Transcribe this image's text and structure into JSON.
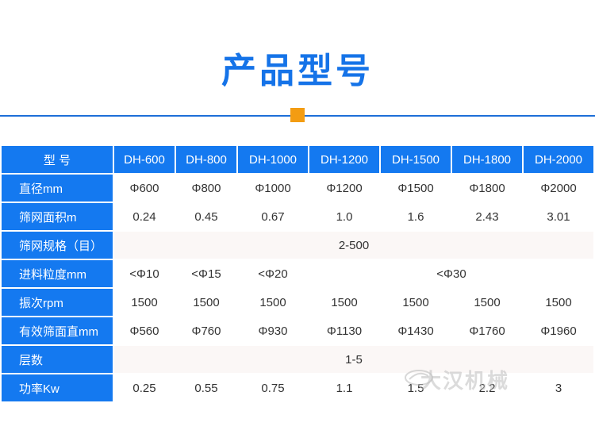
{
  "title": "产品型号",
  "header": {
    "label": "型 号",
    "models": [
      "DH-600",
      "DH-800",
      "DH-1000",
      "DH-1200",
      "DH-1500",
      "DH-1800",
      "DH-2000"
    ]
  },
  "rows": {
    "diameter": {
      "label": "直径mm",
      "values": [
        "Φ600",
        "Φ800",
        "Φ1000",
        "Φ1200",
        "Φ1500",
        "Φ1800",
        "Φ2000"
      ]
    },
    "area": {
      "label": "筛网面积m",
      "values": [
        "0.24",
        "0.45",
        "0.67",
        "1.0",
        "1.6",
        "2.43",
        "3.01"
      ]
    },
    "mesh": {
      "label": "筛网规格（目）",
      "value": "2-500"
    },
    "feed": {
      "label": "进料粒度mm",
      "values": [
        "<Φ10",
        "<Φ15",
        "<Φ20"
      ],
      "merged": "<Φ30"
    },
    "vibration": {
      "label": "振次rpm",
      "values": [
        "1500",
        "1500",
        "1500",
        "1500",
        "1500",
        "1500",
        "1500"
      ]
    },
    "effective": {
      "label": "有效筛面直mm",
      "values": [
        "Φ560",
        "Φ760",
        "Φ930",
        "Φ1130",
        "Φ1430",
        "Φ1760",
        "Φ1960"
      ]
    },
    "layers": {
      "label": "层数",
      "value": "1-5"
    },
    "power": {
      "label": "功率Kw",
      "values": [
        "0.25",
        "0.55",
        "0.75",
        "1.1",
        "1.5",
        "2.2",
        "3"
      ]
    }
  },
  "watermark": "大汉机械",
  "colors": {
    "title": "#1573e8",
    "header_bg": "#1479f0",
    "accent": "#f39c12",
    "rule": "#1d6fd8"
  }
}
